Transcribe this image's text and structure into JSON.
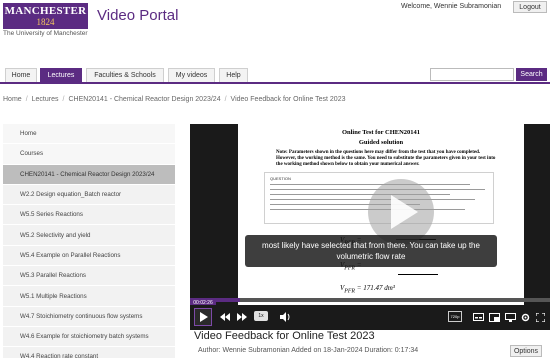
{
  "header": {
    "logo_main": "MANCHESTER",
    "logo_year": "1824",
    "logo_sub": "The University of Manchester",
    "portal_title": "Video Portal",
    "welcome": "Welcome, Wennie Subramonian",
    "logout": "Logout"
  },
  "nav": {
    "tabs": [
      {
        "label": "Home"
      },
      {
        "label": "Lectures"
      },
      {
        "label": "Faculties & Schools"
      },
      {
        "label": "My videos"
      },
      {
        "label": "Help"
      }
    ],
    "active_tab": "Lectures",
    "search_placeholder": "",
    "search_button": "Search"
  },
  "breadcrumb": [
    "Home",
    "Lectures",
    "CHEN20141 - Chemical Reactor Design 2023/24",
    "Video Feedback for Online Test 2023"
  ],
  "sidebar": {
    "items": [
      {
        "label": "Home"
      },
      {
        "label": "Courses"
      },
      {
        "label": "CHEN20141 - Chemical Reactor Design 2023/24"
      },
      {
        "label": "W2.2 Design equation_Batch reactor"
      },
      {
        "label": "W5.5 Series Reactions"
      },
      {
        "label": "W5.2 Selectivity and yield"
      },
      {
        "label": "W5.4 Example on Parallel Reactions"
      },
      {
        "label": "W5.3 Parallel Reactions"
      },
      {
        "label": "W5.1 Multiple Reactions"
      },
      {
        "label": "W4.7 Stoichiometry continuous flow systems"
      },
      {
        "label": "W4.6 Example for stoichiometry batch systems"
      },
      {
        "label": "W4.4 Reaction rate constant"
      }
    ]
  },
  "slide": {
    "title1": "Online Test for CHEN20141",
    "title2": "Guided solution",
    "note": "Note: Parameters shown in the questions here may differ from the test that you have completed. However, the working method is the same. You need to substitute the parameters given in your test into the working method shown below to obtain your numerical answer.",
    "question_label": "QUESTION"
  },
  "player": {
    "caption_line1": "most likely have selected that from there. You can take up the",
    "caption_line2": "volumetric flow rate",
    "current_time": "00:02:26",
    "progress": 0.14,
    "rate": "1x",
    "quality": "720p",
    "colors": {
      "accent": "#5b2b82"
    }
  },
  "video": {
    "title": "Video Feedback for Online Test 2023",
    "meta": "Author: Wennie Subramonian Added on 18-Jan-2024 Duration: 0:17:34",
    "options": "Options"
  }
}
